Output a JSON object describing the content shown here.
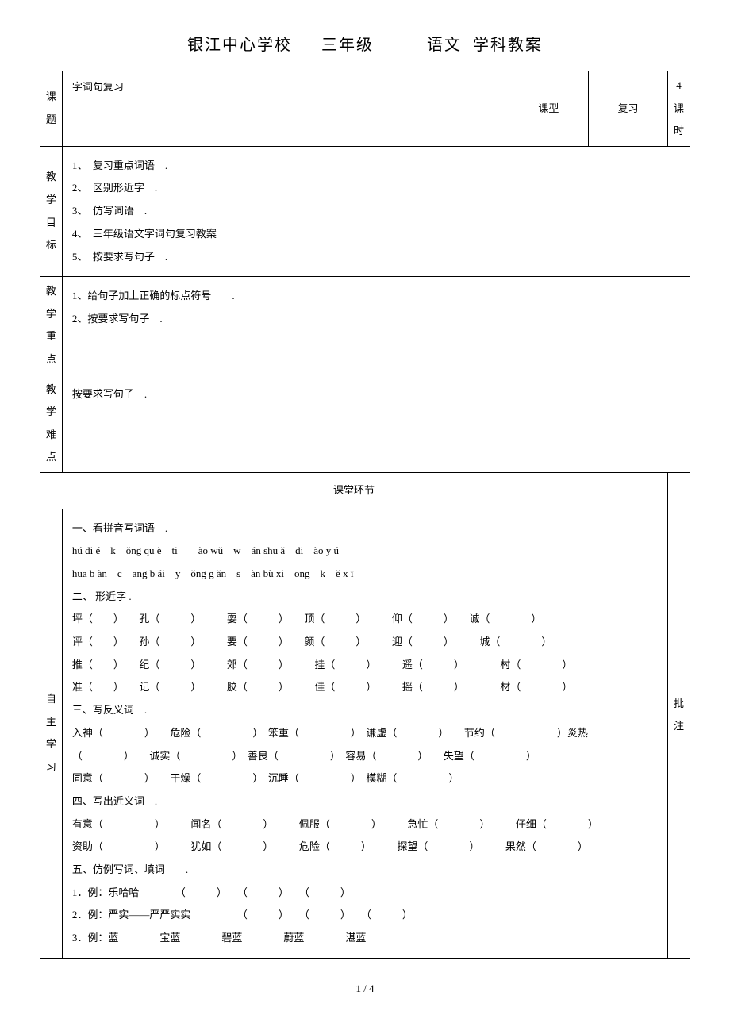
{
  "header": {
    "school": "银江中心学校",
    "grade": "三年级",
    "subject": "语文",
    "suffix": "学科教案"
  },
  "meta": {
    "topic_label": "课题",
    "topic_value": "字词句复习",
    "type_label": "课型",
    "type_value": "复习",
    "hours_value": "4",
    "hours_suffix": "课时"
  },
  "goals": {
    "label": "教学目标",
    "items": [
      "1、　复习重点词语　.",
      "2、　区别形近字　.",
      "3、　仿写词语　.",
      "4、　三年级语文字词句复习教案",
      "5、　按要求写句子　."
    ]
  },
  "keypoints": {
    "label": "教学重点",
    "items": [
      "1、给句子加上正确的标点符号　　.",
      "2、按要求写句子　."
    ]
  },
  "difficult": {
    "label": "教学难点",
    "text": "按要求写句子　."
  },
  "section_title": "课堂环节",
  "notes_label": "批注",
  "study": {
    "label": "自主学习",
    "lines": [
      "一、看拼音写词语　.",
      "hú di é　k　ǒng qu è　ti　　ào wǔ　w　án shu ǎ　di　ào y ú",
      "huā b àn　c　āng b ái　y　ǒng g ǎn　s　àn bù xi　ōng　k　ě x ī",
      "二、 形近字 .",
      "坪（　　）　　孔（　　　）　　　耍（　　　）　　顶（　　　）　　　仰（　　　）　　诚（　　　　）",
      "评（　　）　　孙（　　　）　　　要（　　　）　　颜（　　　）　　　迎（　　　）　　　城（　　　　）",
      "推（　　）　　纪（　　　）　　　郊（　　　）　　　挂（　　　）　　　遥（　　　）　　　　村（　　　　）",
      "准（　　）　　记（　　　）　　　胶（　　　）　　　佳（　　　）　　　摇（　　　）　　　　材（　　　　）",
      "三、写反义词　.",
      "入神（　　　　）　　危险（　　　　　）　笨重（　　　　　）　谦虚（　　　　）　　节约（　　　　　　）炎热",
      "（　　　　）　　诚实（　　　　　）　善良（　　　　　）　容易（　　　　）　　失望（　　　　　）",
      "同意（　　　　）　　干燥（　　　　　）　沉睡（　　　　　）　模糊（　　　　　）",
      "四、写出近义词　.",
      "有意（　　　　　）　　　闻名（　　　　）　　　佩服（　　　　）　　　急忙（　　　　）　　　仔细（　　　　）",
      "资助（　　　　　）　　　犹如（　　　　）　　　危险（　　　）　　　探望（　　　　）　　　果然（　　　　）",
      "五、仿例写词、填词　　.",
      "1．例：乐哈哈　　　　（　　　）　　（　　　）　　（　　　）",
      "2．例：严实——严严实实　　　　　（　　　）　　（　　　）　　（　　　）",
      "3．例：蓝　　　　宝蓝　　　　碧蓝　　　　蔚蓝　　　　湛蓝"
    ]
  },
  "footer": "1 / 4"
}
